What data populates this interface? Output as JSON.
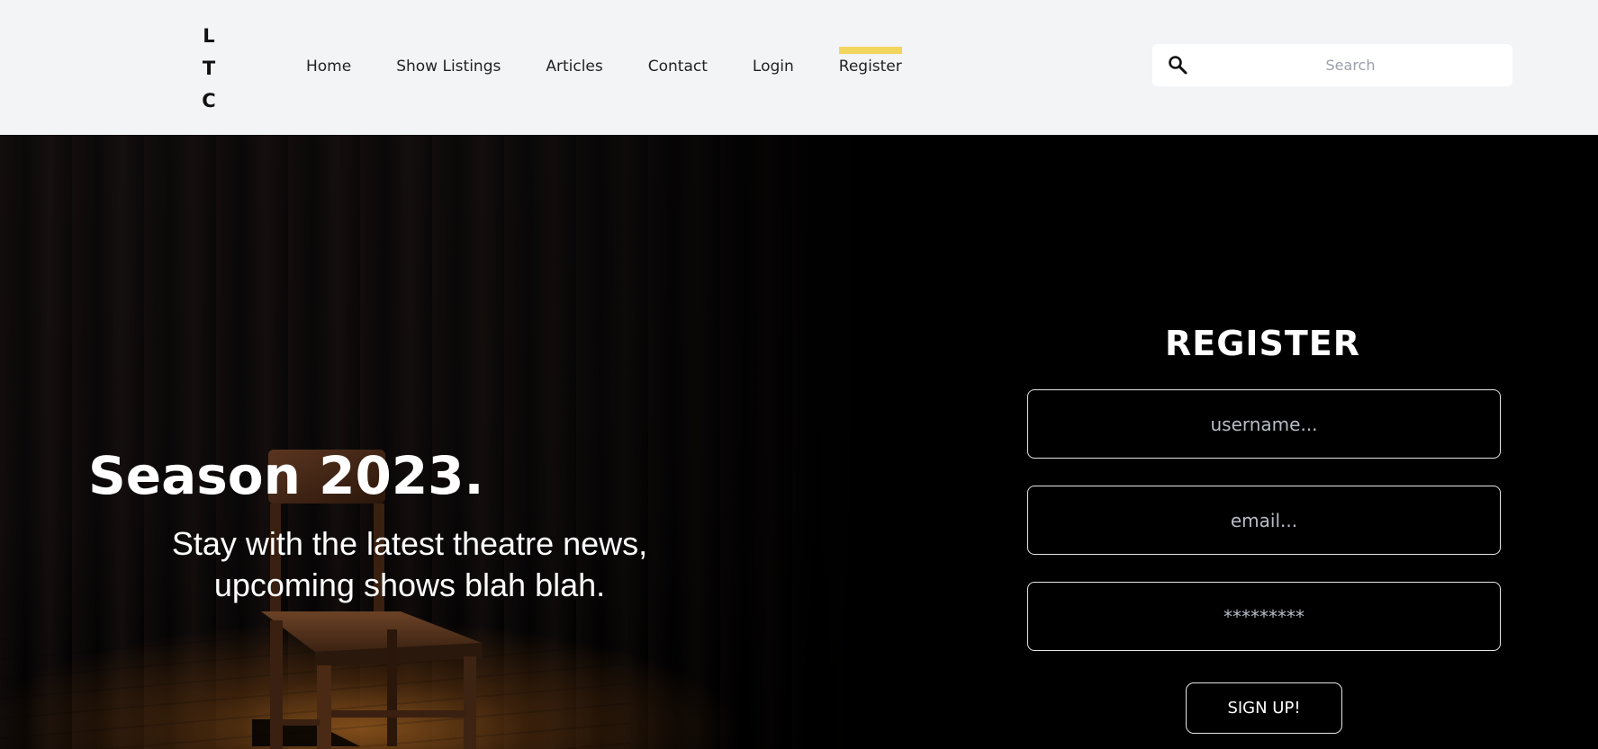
{
  "header": {
    "logo_letters": [
      "L",
      "T",
      "C"
    ],
    "nav": [
      {
        "label": "Home",
        "active": false
      },
      {
        "label": "Show Listings",
        "active": false
      },
      {
        "label": "Articles",
        "active": false
      },
      {
        "label": "Contact",
        "active": false
      },
      {
        "label": "Login",
        "active": false
      },
      {
        "label": "Register",
        "active": true
      }
    ],
    "search_placeholder": "Search",
    "active_color": "#f2d55c"
  },
  "hero": {
    "title": "Season 2023.",
    "subtitle": "Stay with the latest theatre news, upcoming shows blah blah."
  },
  "register": {
    "title": "REGISTER",
    "username_placeholder": "username...",
    "email_placeholder": "email...",
    "password_placeholder": "*********",
    "submit_label": "SIGN UP!"
  }
}
